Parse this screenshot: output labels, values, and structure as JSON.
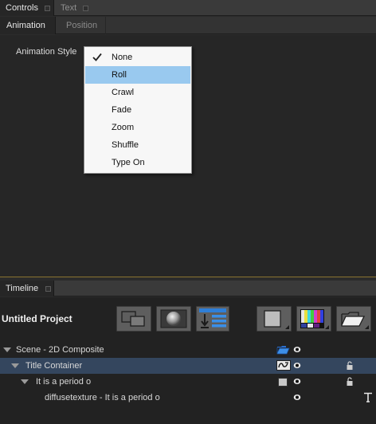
{
  "panel_tabs": [
    {
      "label": "Controls"
    },
    {
      "label": "Text"
    }
  ],
  "sub_tabs": [
    {
      "label": "Animation"
    },
    {
      "label": "Position"
    }
  ],
  "animation_style": {
    "label": "Animation Style",
    "options": [
      "None",
      "Roll",
      "Crawl",
      "Fade",
      "Zoom",
      "Shuffle",
      "Type On"
    ],
    "checked": "None",
    "highlighted": "Roll"
  },
  "timeline": {
    "tab_label": "Timeline",
    "project_title": "Untitled Project",
    "toolbar_icons": [
      "layout-icon",
      "sphere-icon",
      "import-list-icon",
      "square-icon",
      "color-bars-icon",
      "folder-icon"
    ],
    "tree": [
      {
        "label": "Scene - 2D Composite",
        "icon": "folder-icon"
      },
      {
        "label": "Title Container",
        "icon": "text-style-icon",
        "selected": true
      },
      {
        "label": "It is a period o",
        "icon": "square-icon"
      },
      {
        "label": "diffusetexture - It is a period o",
        "icon": "text-t-icon"
      }
    ]
  },
  "colors": {
    "accent_highlight": "#99c9ef",
    "selected_row": "#34465e",
    "divider": "#8a7330"
  }
}
